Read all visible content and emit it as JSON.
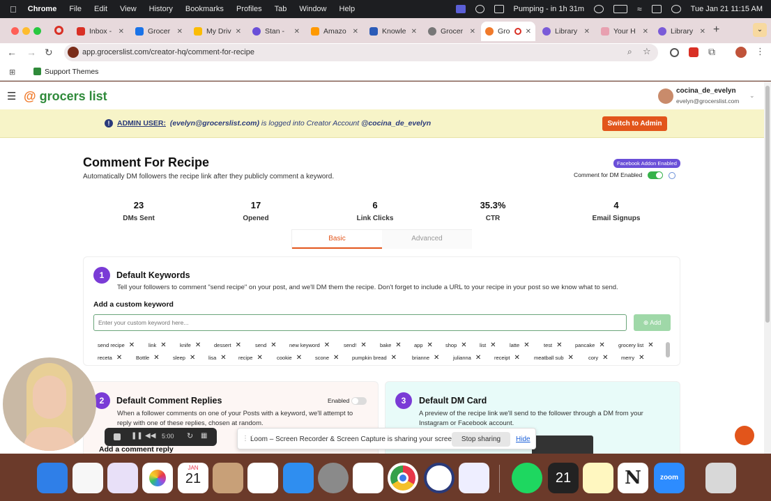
{
  "menubar": {
    "app": "Chrome",
    "items": [
      "File",
      "Edit",
      "View",
      "History",
      "Bookmarks",
      "Profiles",
      "Tab",
      "Window",
      "Help"
    ],
    "status": "Pumping - in 1h 31m",
    "datetime": "Tue Jan 21  11:15 AM"
  },
  "tabs": [
    {
      "label": "Inbox -",
      "color": "#d93025"
    },
    {
      "label": "Grocer",
      "color": "#1a73e8"
    },
    {
      "label": "My Driv",
      "color": "#fbbc04"
    },
    {
      "label": "Stan -",
      "color": "#6a4fd8"
    },
    {
      "label": "Amazo",
      "color": "#ff9900"
    },
    {
      "label": "Knowle",
      "color": "#2b5bb8"
    },
    {
      "label": "Grocer",
      "color": "#777777"
    },
    {
      "label": "Gro",
      "color": "#f07a2b"
    },
    {
      "label": "Library",
      "color": "#7a5bd8"
    },
    {
      "label": "Your H",
      "color": "#e8a0b0"
    },
    {
      "label": "Library",
      "color": "#7a5bd8"
    }
  ],
  "address": {
    "url": "app.grocerslist.com/creator-hq/comment-for-recipe"
  },
  "bookmarks": {
    "item": "Support Themes"
  },
  "header": {
    "logo": "grocers list",
    "user_name": "cocina_de_evelyn",
    "user_email": "evelyn@grocerslist.com"
  },
  "banner": {
    "label": "ADMIN USER:",
    "email": "(evelyn@grocerslist.com)",
    "text": "is logged into Creator Account",
    "account": "@cocina_de_evelyn",
    "button": "Switch to Admin"
  },
  "page": {
    "title": "Comment For Recipe",
    "subtitle": "Automatically DM followers the recipe link after they publicly comment a keyword.",
    "badge": "Facebook Addon Enabled",
    "toggle_label": "Comment for DM Enabled"
  },
  "stats": [
    {
      "value": "23",
      "label": "DMs Sent"
    },
    {
      "value": "17",
      "label": "Opened"
    },
    {
      "value": "6",
      "label": "Link Clicks"
    },
    {
      "value": "35.3%",
      "label": "CTR"
    },
    {
      "value": "4",
      "label": "Email Signups"
    }
  ],
  "subtabs": {
    "basic": "Basic",
    "advanced": "Advanced"
  },
  "keywords_card": {
    "num": "1",
    "title": "Default Keywords",
    "desc": "Tell your followers to comment \"send recipe\" on your post, and we'll DM them the recipe. Don't forget to include a URL to your recipe in your post so we know what to send.",
    "add_label": "Add a custom keyword",
    "placeholder": "Enter your custom keyword here...",
    "add_button": "Add",
    "row1": [
      "send recipe",
      "link",
      "knife",
      "dessert",
      "send",
      "new keyword",
      "send!",
      "bake",
      "app",
      "shop",
      "list",
      "latte",
      "test",
      "pancake",
      "grocery list"
    ],
    "row2": [
      "receta",
      "Bottle",
      "sleep",
      "lisa",
      "recipe",
      "cookie",
      "scone",
      "pumpkin bread",
      "brianne",
      "julianna",
      "receipt",
      "meatball sub",
      "cory",
      "merry"
    ]
  },
  "replies_card": {
    "num": "2",
    "title": "Default Comment Replies",
    "toggle_label": "Enabled",
    "desc": "When a follower comments on one of your Posts with a keyword, we'll attempt to reply with one of these replies, chosen at random.",
    "add_label": "Add a comment reply"
  },
  "dm_card": {
    "num": "3",
    "title": "Default DM Card",
    "desc": "A preview of the recipe link we'll send to the follower through a DM from your Instagram or Facebook account."
  },
  "recorder": {
    "time": "5:00"
  },
  "loom": {
    "text": "Loom – Screen Recorder & Screen Capture is sharing your screen.",
    "stop": "Stop sharing",
    "hide": "Hide"
  },
  "dock": {
    "calendar_month": "JAN",
    "calendar_day": "21",
    "badge_day": "21"
  }
}
